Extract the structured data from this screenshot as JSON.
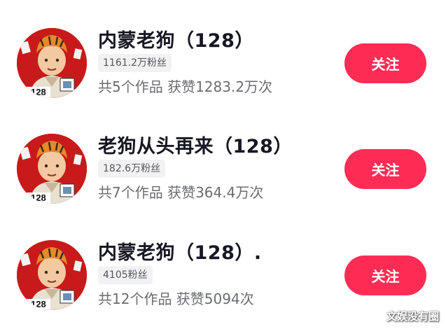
{
  "accounts": [
    {
      "name": "内蒙老狗（128）",
      "fans": "1161.2万粉丝",
      "stats": "共5个作品 获赞1283.2万次",
      "follow_label": "关注",
      "avatar_badge": "128"
    },
    {
      "name": "老狗从头再来（128）",
      "fans": "182.6万粉丝",
      "stats": "共7个作品 获赞364.4万次",
      "follow_label": "关注",
      "avatar_badge": "128"
    },
    {
      "name": "内蒙老狗（128）.",
      "fans": "4105粉丝",
      "stats": "共12个作品 获赞5094次",
      "follow_label": "关注",
      "avatar_badge": "128"
    }
  ],
  "watermark": "文娱没有圈",
  "colors": {
    "follow_button": "#fe2c55",
    "avatar_background": "#c81a1a",
    "fans_badge_bg": "#f2f2f4"
  }
}
